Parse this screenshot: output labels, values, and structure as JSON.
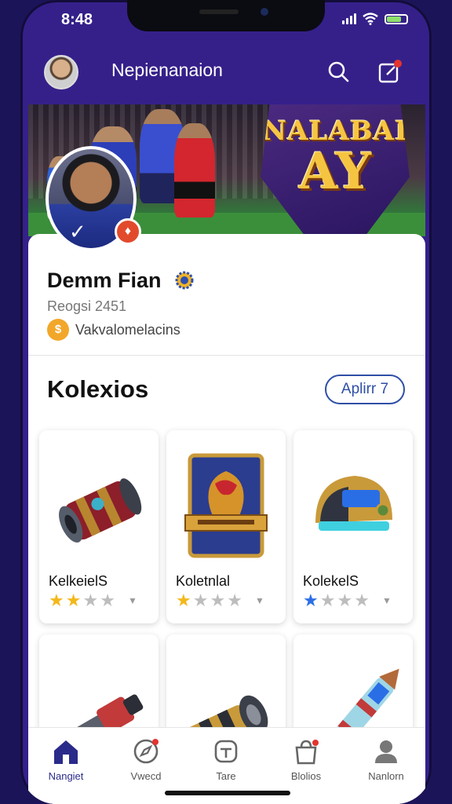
{
  "status_bar": {
    "time": "8:48"
  },
  "header": {
    "title": "Nepienanaion"
  },
  "banner": {
    "logo_line1": "NALABAI",
    "logo_line2": "AY"
  },
  "profile": {
    "name": "Demm Fian",
    "subtitle": "Reogsi 2451",
    "tag": "Vakvalomelacins"
  },
  "collection": {
    "title": "Kolexios",
    "action_label": "Aplirr 7",
    "cards": [
      {
        "name": "KelkeielS",
        "rating": 2,
        "star_color": "#f3b81b",
        "icon": "cylinder-artifact-icon"
      },
      {
        "name": "Koletnlal",
        "rating": 1,
        "star_color": "#f3b81b",
        "icon": "crest-shield-icon"
      },
      {
        "name": "KolekelS",
        "rating": 1,
        "star_color": "#2a6ee6",
        "icon": "helmet-artifact-icon"
      },
      {
        "name": "",
        "rating": 0,
        "icon": "blaster-icon"
      },
      {
        "name": "",
        "rating": 0,
        "icon": "cannon-icon"
      },
      {
        "name": "",
        "rating": 0,
        "icon": "rocket-icon"
      }
    ]
  },
  "bottom_nav": {
    "items": [
      {
        "label": "Nangiet",
        "icon": "home-icon",
        "active": true
      },
      {
        "label": "Vwecd",
        "icon": "compass-icon",
        "active": false
      },
      {
        "label": "Tare",
        "icon": "tag-icon",
        "active": false
      },
      {
        "label": "Blolios",
        "icon": "bag-icon",
        "active": false
      },
      {
        "label": "Nanlorn",
        "icon": "person-icon",
        "active": false
      }
    ]
  },
  "colors": {
    "brand": "#35208a",
    "accent": "#2f4fa6",
    "star_gold": "#f3b81b"
  }
}
